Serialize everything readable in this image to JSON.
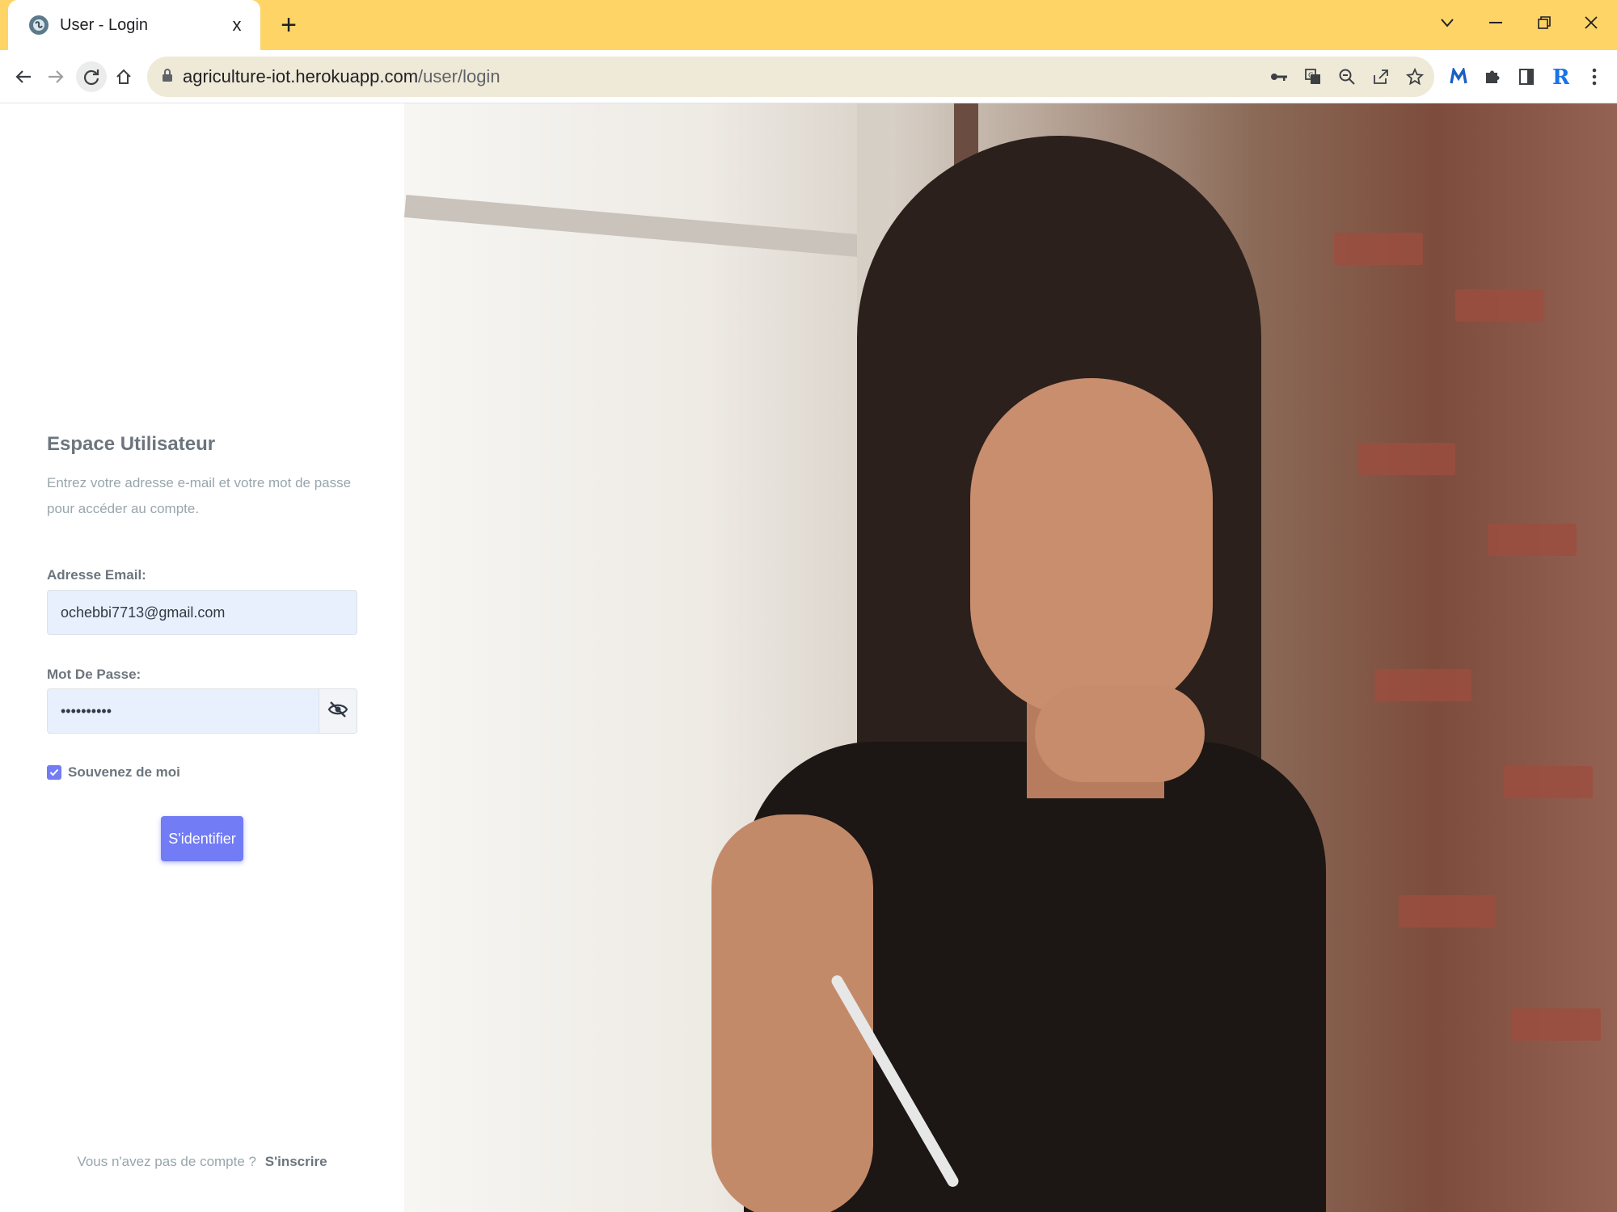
{
  "browser": {
    "tab_title": "User - Login",
    "tab_close": "x",
    "new_tab": "+",
    "url_host": "agriculture-iot.herokuapp.com",
    "url_path": "/user/login",
    "accent_color": "#fed466"
  },
  "login": {
    "title": "Espace Utilisateur",
    "description": "Entrez votre adresse e-mail et votre mot de passe pour accéder au compte.",
    "email_label": "Adresse Email:",
    "email_value": "ochebbi7713@gmail.com",
    "password_label": "Mot De Passe:",
    "password_value": "••••••••••",
    "remember_label": "Souvenez de moi",
    "remember_checked": true,
    "submit_label": "S'identifier",
    "button_color": "#727cf5"
  },
  "footer": {
    "prompt": "Vous n'avez pas de compte ?",
    "link": "S'inscrire"
  }
}
